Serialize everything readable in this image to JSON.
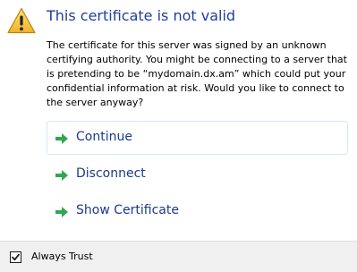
{
  "dialog": {
    "title": "This certificate is not valid",
    "message": "The certificate for this server was signed by an unknown certifying authority. You might be connecting to a server that is pretending to be “mydomain.dx.am” which could put your confidential information at risk. Would you like to connect to the server anyway?",
    "icon": "warning-icon"
  },
  "actions": [
    {
      "label": "Continue",
      "icon": "green-arrow-icon"
    },
    {
      "label": "Disconnect",
      "icon": "green-arrow-icon"
    },
    {
      "label": "Show Certificate",
      "icon": "green-arrow-icon"
    }
  ],
  "footer": {
    "always_trust_label": "Always Trust",
    "always_trust_checked": true
  },
  "colors": {
    "title": "#1f3f9a",
    "link": "#1a3a8f",
    "arrow": "#2fa84f",
    "warning": "#f5c542",
    "footer_bg": "#f0f0f0"
  }
}
